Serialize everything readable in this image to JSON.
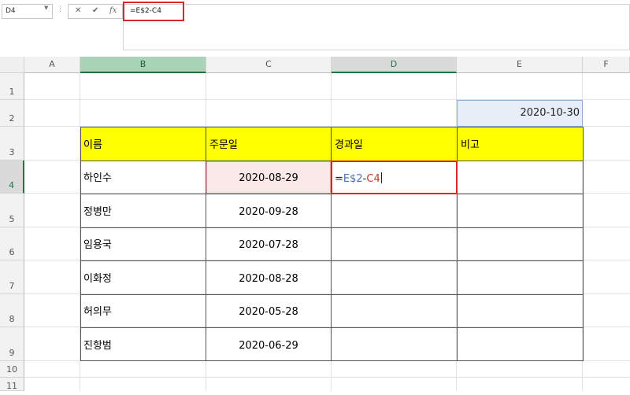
{
  "formula_bar": {
    "name_box": "D4",
    "cancel_icon": "✕",
    "enter_icon": "✔",
    "fx_icon": "fx",
    "formula": "=E$2-C4"
  },
  "columns": [
    "A",
    "B",
    "C",
    "D",
    "E",
    "F"
  ],
  "rows": [
    "1",
    "2",
    "3",
    "4",
    "5",
    "6",
    "7",
    "8",
    "9",
    "10",
    "11"
  ],
  "sheet": {
    "e2_value": "2020-10-30",
    "headers": {
      "name": "이름",
      "order_date": "주문일",
      "elapsed": "경과일",
      "note": "비고"
    },
    "table_rows": [
      {
        "name": "하인수",
        "order_date": "2020-08-29"
      },
      {
        "name": "정병만",
        "order_date": "2020-09-28"
      },
      {
        "name": "임용국",
        "order_date": "2020-07-28"
      },
      {
        "name": "이화정",
        "order_date": "2020-08-28"
      },
      {
        "name": "허의무",
        "order_date": "2020-05-28"
      },
      {
        "name": "진항범",
        "order_date": "2020-06-29"
      }
    ],
    "editing_cell": {
      "eq": "=",
      "ref1": "E$2",
      "op": "-",
      "ref2": "C4"
    }
  },
  "colors": {
    "ref1_color": "#4472c4",
    "ref2_color": "#c0392b",
    "highlight": "#d9262c",
    "header_fill": "#ffff00",
    "selected_col_header": "#a9d5b6",
    "e2_fill": "#e8eef8",
    "c4_fill": "#fbe9e9"
  }
}
